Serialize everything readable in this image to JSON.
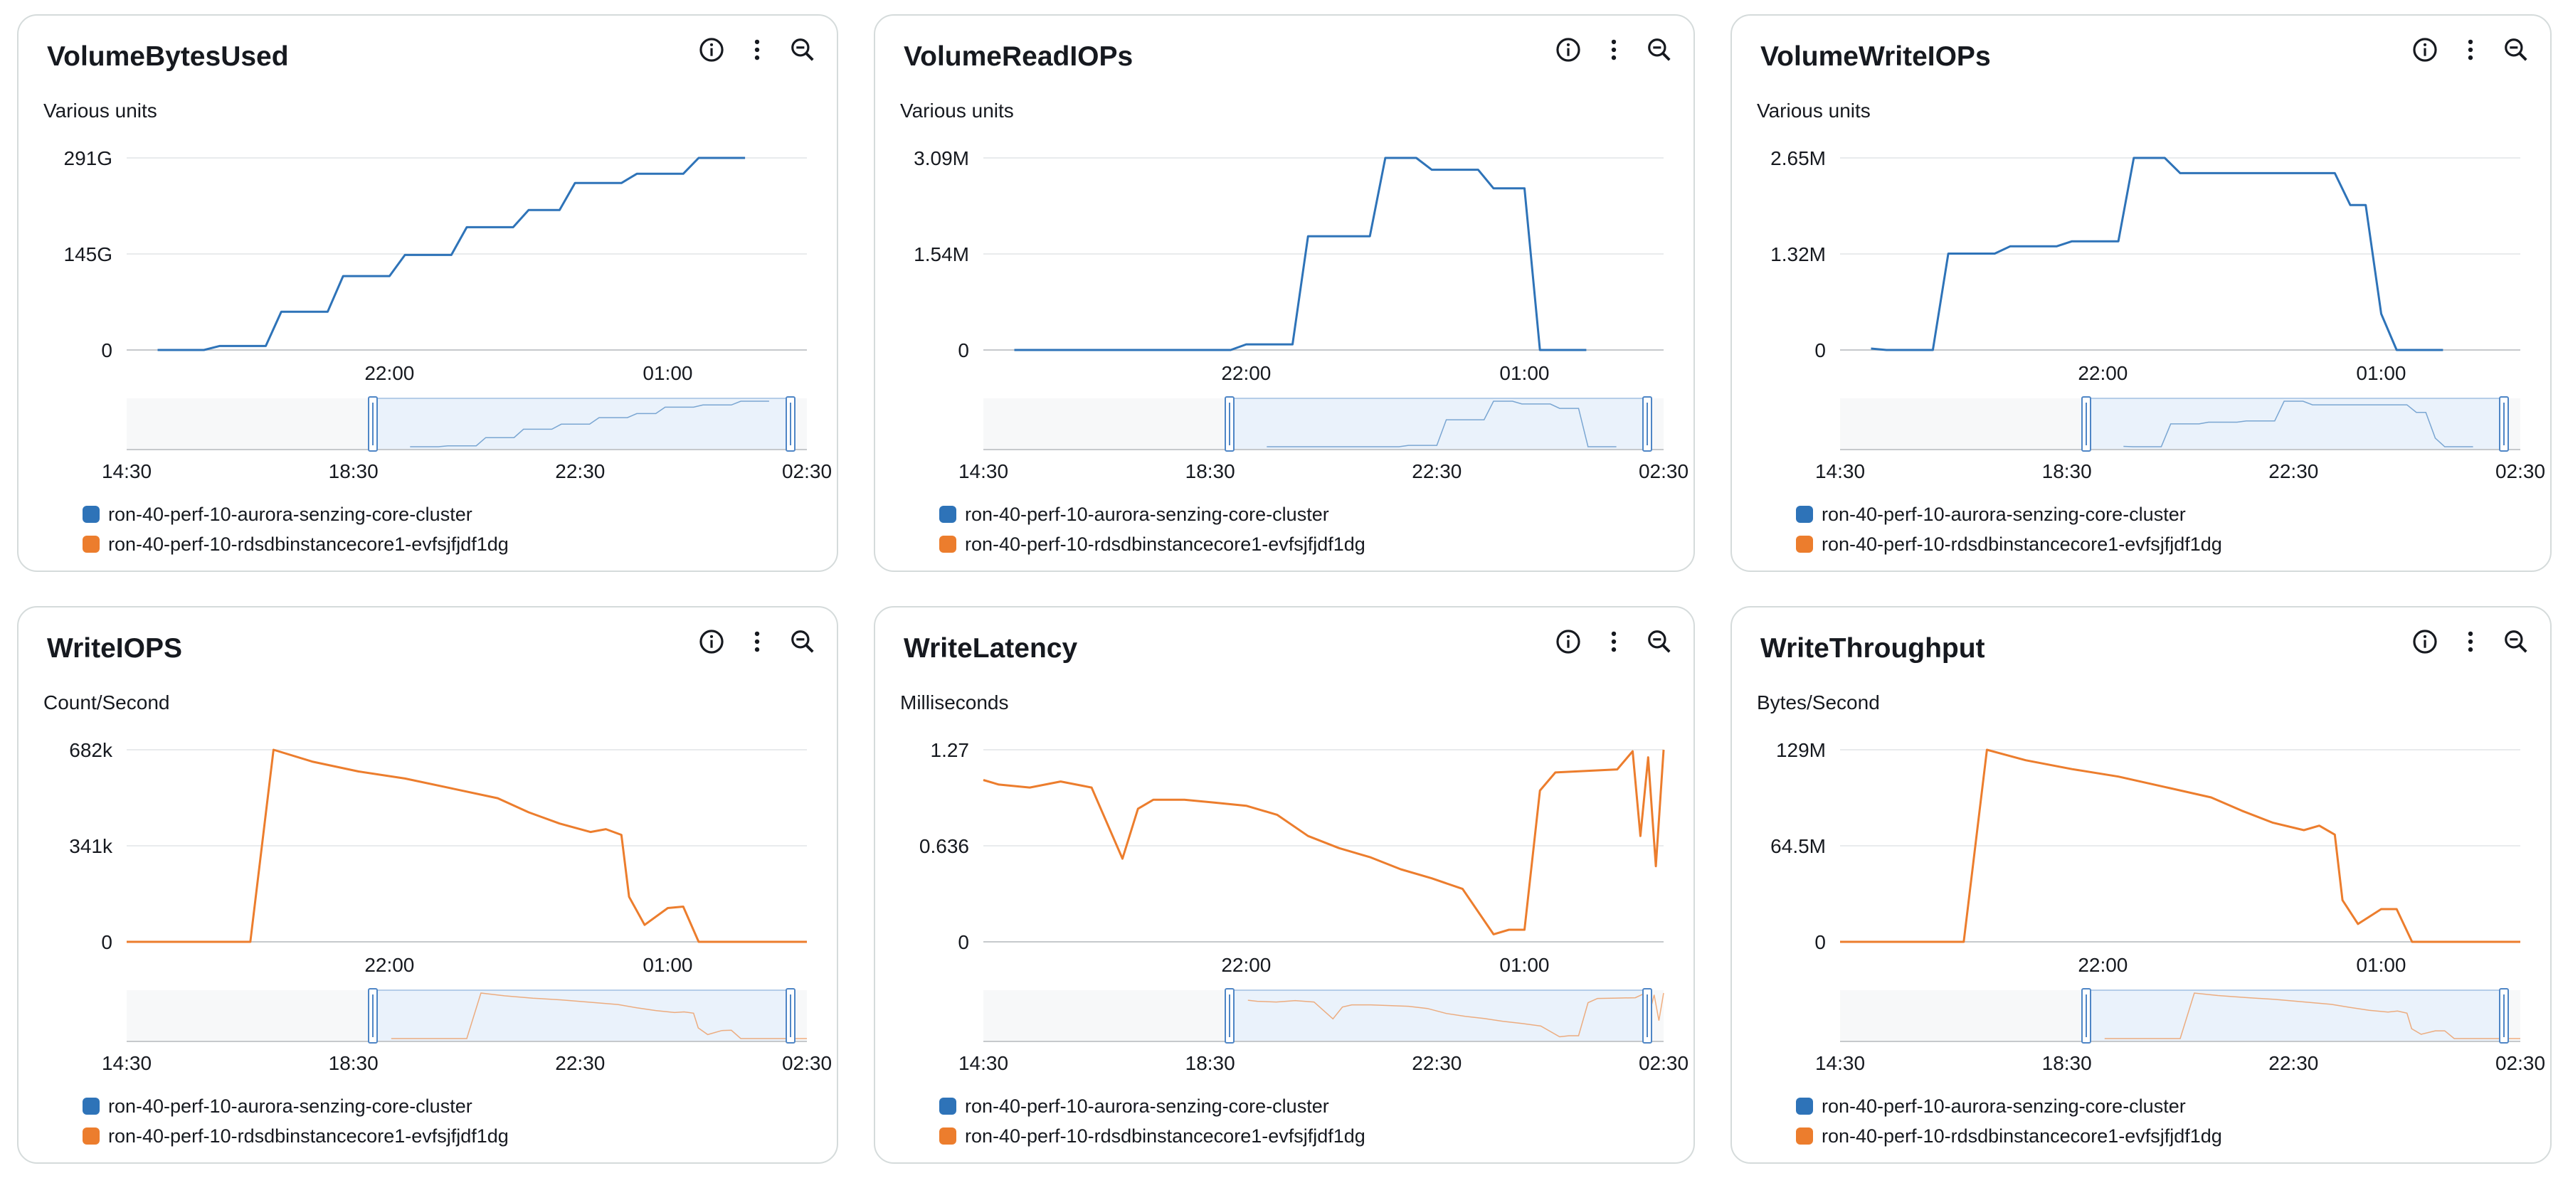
{
  "colors": {
    "cluster": "#2e73b8",
    "instance": "#ec7d2d",
    "grid": "#e9ebed",
    "nav_fill": "#eaf2fb",
    "nav_border": "#4f86c6"
  },
  "icons": [
    "info-icon",
    "more-options-icon",
    "zoom-out-icon"
  ],
  "legend": [
    {
      "label": "ron-40-perf-10-aurora-senzing-core-cluster",
      "color": "#2e73b8"
    },
    {
      "label": "ron-40-perf-10-rdsdbinstancecore1-evfsjfjdf1dg",
      "color": "#ec7d2d"
    }
  ],
  "chart_data": [
    {
      "type": "line",
      "title": "VolumeBytesUsed",
      "units": "Various units",
      "y_ticks": [
        "291G",
        "145G",
        "0"
      ],
      "ylim": [
        0,
        291
      ],
      "x_ticks": [
        "22:00",
        "01:00"
      ],
      "xlim": [
        "19:10",
        "02:30"
      ],
      "nav_ticks": [
        "14:30",
        "18:30",
        "22:30",
        "02:30"
      ],
      "series": [
        {
          "name": "ron-40-perf-10-aurora-senzing-core-cluster",
          "color": "#2e73b8",
          "x": [
            "19:30",
            "20:00",
            "20:10",
            "20:40",
            "20:50",
            "21:20",
            "21:30",
            "22:00",
            "22:10",
            "22:40",
            "22:50",
            "23:20",
            "23:30",
            "23:50",
            "00:00",
            "00:30",
            "00:40",
            "01:10",
            "01:20",
            "01:50"
          ],
          "y": [
            0,
            0,
            6,
            6,
            58,
            58,
            112,
            112,
            144,
            144,
            186,
            186,
            212,
            212,
            253,
            253,
            267,
            267,
            291,
            291
          ]
        }
      ]
    },
    {
      "type": "line",
      "title": "VolumeReadIOPs",
      "units": "Various units",
      "y_ticks": [
        "3.09M",
        "1.54M",
        "0"
      ],
      "ylim": [
        0,
        3.09
      ],
      "x_ticks": [
        "22:00",
        "01:00"
      ],
      "xlim": [
        "19:10",
        "02:30"
      ],
      "nav_ticks": [
        "14:30",
        "18:30",
        "22:30",
        "02:30"
      ],
      "series": [
        {
          "name": "ron-40-perf-10-aurora-senzing-core-cluster",
          "color": "#2e73b8",
          "x": [
            "19:30",
            "21:50",
            "22:00",
            "22:30",
            "22:40",
            "23:20",
            "23:30",
            "23:50",
            "00:00",
            "00:30",
            "00:40",
            "01:00",
            "01:10",
            "01:40"
          ],
          "y": [
            0,
            0,
            0.09,
            0.09,
            1.83,
            1.83,
            3.09,
            3.09,
            2.9,
            2.9,
            2.6,
            2.6,
            0,
            0
          ]
        }
      ]
    },
    {
      "type": "line",
      "title": "VolumeWriteIOPs",
      "units": "Various units",
      "y_ticks": [
        "2.65M",
        "1.32M",
        "0"
      ],
      "ylim": [
        0,
        2.65
      ],
      "x_ticks": [
        "22:00",
        "01:00"
      ],
      "xlim": [
        "19:10",
        "02:30"
      ],
      "nav_ticks": [
        "14:30",
        "18:30",
        "22:30",
        "02:30"
      ],
      "series": [
        {
          "name": "ron-40-perf-10-aurora-senzing-core-cluster",
          "color": "#2e73b8",
          "x": [
            "19:30",
            "19:40",
            "20:10",
            "20:20",
            "20:50",
            "21:00",
            "21:30",
            "21:40",
            "22:10",
            "22:20",
            "22:40",
            "22:50",
            "23:20",
            "23:30",
            "23:50",
            "00:00",
            "00:30",
            "00:40",
            "00:50",
            "01:00",
            "01:10",
            "01:40"
          ],
          "y": [
            0.02,
            0,
            0,
            1.33,
            1.33,
            1.43,
            1.43,
            1.5,
            1.5,
            2.65,
            2.65,
            2.44,
            2.44,
            2.44,
            2.44,
            2.44,
            2.44,
            2.0,
            2.0,
            0.5,
            0,
            0
          ]
        }
      ]
    },
    {
      "type": "line",
      "title": "WriteIOPS",
      "units": "Count/Second",
      "y_ticks": [
        "682k",
        "341k",
        "0"
      ],
      "ylim": [
        0,
        682
      ],
      "x_ticks": [
        "22:00",
        "01:00"
      ],
      "xlim": [
        "19:10",
        "02:30"
      ],
      "nav_ticks": [
        "14:30",
        "18:30",
        "22:30",
        "02:30"
      ],
      "series": [
        {
          "name": "ron-40-perf-10-rdsdbinstancecore1-evfsjfjdf1dg",
          "color": "#ec7d2d",
          "x": [
            "19:10",
            "19:30",
            "20:00",
            "20:30",
            "20:45",
            "21:10",
            "21:40",
            "22:10",
            "22:40",
            "23:10",
            "23:30",
            "23:50",
            "00:10",
            "00:20",
            "00:30",
            "00:35",
            "00:45",
            "01:00",
            "01:10",
            "01:20",
            "01:50",
            "02:10",
            "02:30"
          ],
          "y": [
            0,
            0,
            0,
            0,
            682,
            640,
            605,
            580,
            545,
            510,
            460,
            420,
            390,
            400,
            380,
            160,
            60,
            120,
            125,
            0,
            0,
            0,
            0
          ]
        }
      ]
    },
    {
      "type": "line",
      "title": "WriteLatency",
      "units": "Milliseconds",
      "y_ticks": [
        "1.27",
        "0.636",
        "0"
      ],
      "ylim": [
        0,
        1.27
      ],
      "x_ticks": [
        "22:00",
        "01:00"
      ],
      "xlim": [
        "19:10",
        "02:30"
      ],
      "nav_ticks": [
        "14:30",
        "18:30",
        "22:30",
        "02:30"
      ],
      "series": [
        {
          "name": "ron-40-perf-10-rdsdbinstancecore1-evfsjfjdf1dg",
          "color": "#ec7d2d",
          "x": [
            "19:10",
            "19:20",
            "19:40",
            "20:00",
            "20:20",
            "20:40",
            "20:50",
            "21:00",
            "21:20",
            "21:40",
            "22:00",
            "22:20",
            "22:40",
            "23:00",
            "23:20",
            "23:40",
            "00:00",
            "00:20",
            "00:40",
            "00:50",
            "01:00",
            "01:10",
            "01:20",
            "01:40",
            "02:00",
            "02:10",
            "02:15",
            "02:20",
            "02:25",
            "02:30"
          ],
          "y": [
            1.07,
            1.04,
            1.02,
            1.06,
            1.02,
            0.55,
            0.88,
            0.94,
            0.94,
            0.92,
            0.9,
            0.84,
            0.7,
            0.62,
            0.56,
            0.48,
            0.42,
            0.35,
            0.05,
            0.08,
            0.08,
            1.0,
            1.12,
            1.13,
            1.14,
            1.26,
            0.7,
            1.22,
            0.5,
            1.27
          ]
        }
      ]
    },
    {
      "type": "line",
      "title": "WriteThroughput",
      "units": "Bytes/Second",
      "y_ticks": [
        "129M",
        "64.5M",
        "0"
      ],
      "ylim": [
        0,
        129
      ],
      "x_ticks": [
        "22:00",
        "01:00"
      ],
      "xlim": [
        "19:10",
        "02:30"
      ],
      "nav_ticks": [
        "14:30",
        "18:30",
        "22:30",
        "02:30"
      ],
      "series": [
        {
          "name": "ron-40-perf-10-rdsdbinstancecore1-evfsjfjdf1dg",
          "color": "#ec7d2d",
          "x": [
            "19:10",
            "19:30",
            "20:00",
            "20:30",
            "20:45",
            "21:10",
            "21:40",
            "22:10",
            "22:40",
            "23:10",
            "23:30",
            "23:50",
            "00:10",
            "00:20",
            "00:30",
            "00:35",
            "00:45",
            "01:00",
            "01:10",
            "01:20",
            "01:50",
            "02:10",
            "02:30"
          ],
          "y": [
            0,
            0,
            0,
            0,
            129,
            122,
            116,
            111,
            104,
            97,
            88,
            80,
            75,
            78,
            72,
            28,
            12,
            22,
            22,
            0,
            0,
            0,
            0
          ]
        }
      ]
    }
  ]
}
